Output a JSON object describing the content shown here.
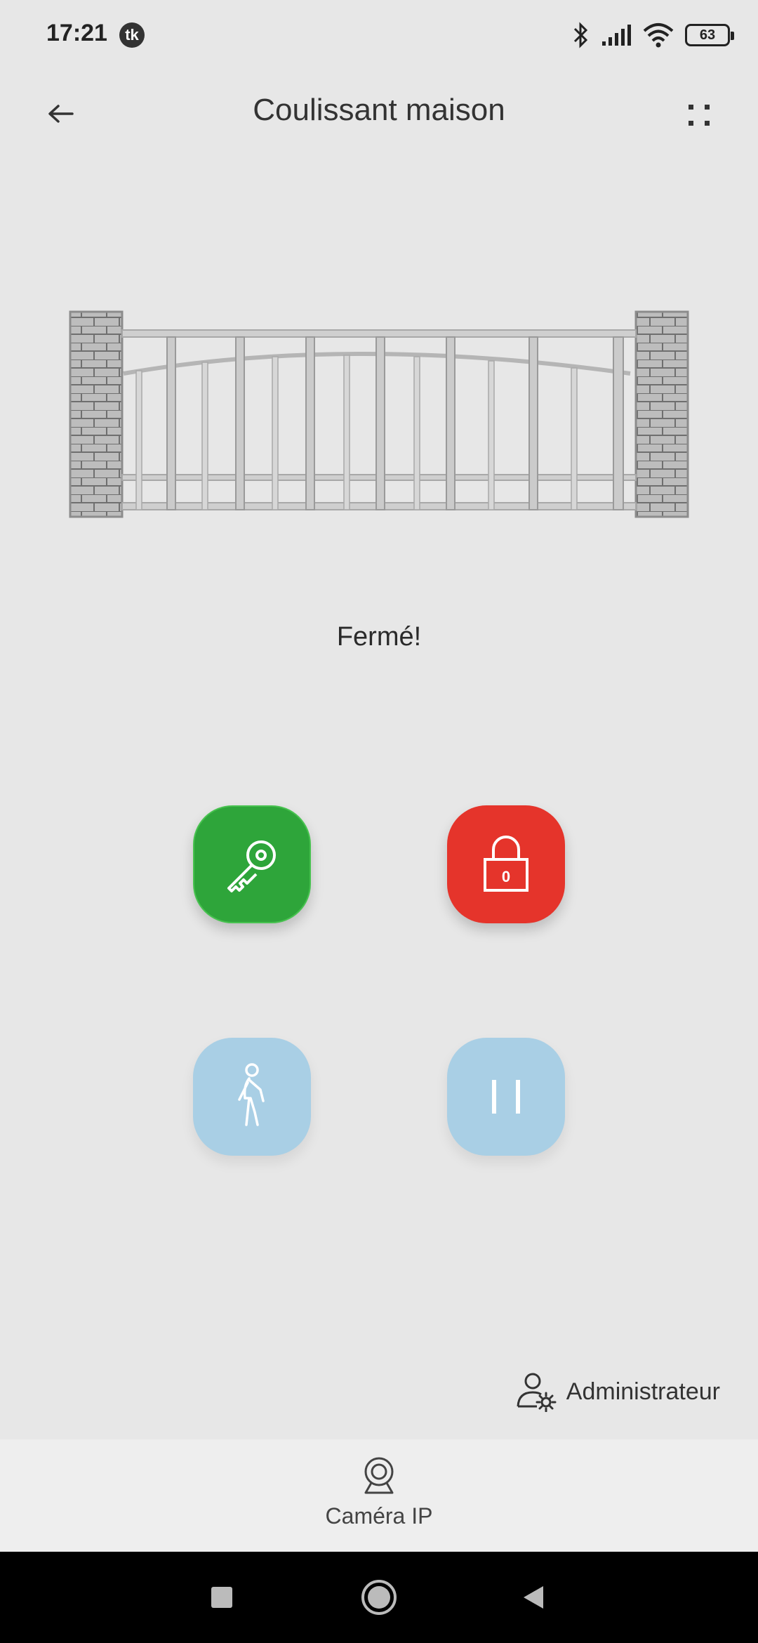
{
  "status_bar": {
    "time": "17:21",
    "notification_badge": "tk",
    "battery": "63",
    "icons": [
      "bluetooth-icon",
      "signal-icon",
      "wifi-icon",
      "battery-icon"
    ]
  },
  "header": {
    "title": "Coulissant maison",
    "back_icon": "arrow-left-icon",
    "menu_icon": "grid-dots-icon"
  },
  "gate": {
    "state": "Fermé!"
  },
  "actions": [
    {
      "name": "open",
      "icon": "key-icon",
      "color": "#2ea53a"
    },
    {
      "name": "close",
      "icon": "lock-icon",
      "color": "#e5342b",
      "lock_text": "0"
    },
    {
      "name": "pedestrian",
      "icon": "walking-person-icon",
      "color": "#a9cfe5"
    },
    {
      "name": "stop",
      "icon": "pause-icon",
      "color": "#a9cfe5"
    }
  ],
  "admin": {
    "label": "Administrateur",
    "icon": "user-settings-icon"
  },
  "bottom_bar": {
    "camera_label": "Caméra IP",
    "camera_icon": "webcam-icon"
  },
  "nav_bar": {
    "icons": [
      "square-recents-icon",
      "circle-home-icon",
      "triangle-back-icon"
    ]
  }
}
